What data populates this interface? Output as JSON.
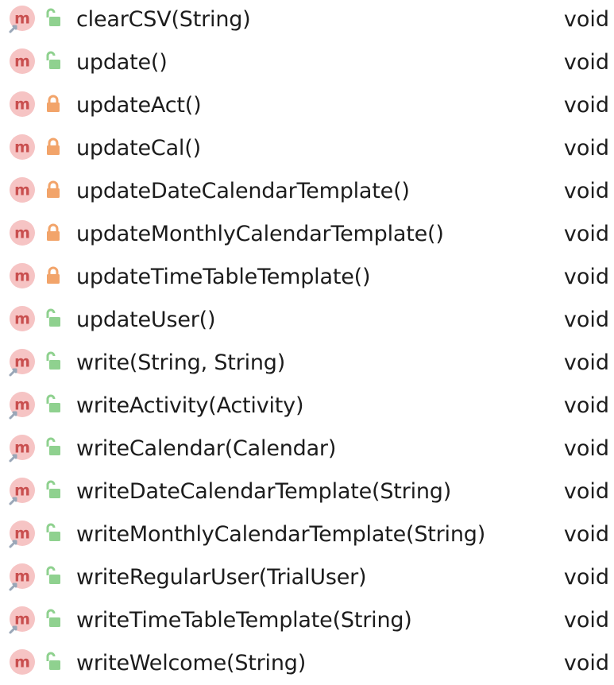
{
  "colors": {
    "method_badge_fill": "#f6c4c4",
    "method_badge_text": "#c94f4f",
    "override_arrow": "#9aa7b8",
    "lock_public": "#8fd18f",
    "lock_private": "#f2a46a",
    "text": "#1c1c1c"
  },
  "methods": [
    {
      "signature": "clearCSV(String)",
      "return_type": "void",
      "visibility": "public",
      "override": true
    },
    {
      "signature": "update()",
      "return_type": "void",
      "visibility": "public",
      "override": false
    },
    {
      "signature": "updateAct()",
      "return_type": "void",
      "visibility": "private",
      "override": false
    },
    {
      "signature": "updateCal()",
      "return_type": "void",
      "visibility": "private",
      "override": false
    },
    {
      "signature": "updateDateCalendarTemplate()",
      "return_type": "void",
      "visibility": "private",
      "override": false
    },
    {
      "signature": "updateMonthlyCalendarTemplate()",
      "return_type": "void",
      "visibility": "private",
      "override": false
    },
    {
      "signature": "updateTimeTableTemplate()",
      "return_type": "void",
      "visibility": "private",
      "override": false
    },
    {
      "signature": "updateUser()",
      "return_type": "void",
      "visibility": "public",
      "override": false
    },
    {
      "signature": "write(String, String)",
      "return_type": "void",
      "visibility": "public",
      "override": true
    },
    {
      "signature": "writeActivity(Activity)",
      "return_type": "void",
      "visibility": "public",
      "override": true
    },
    {
      "signature": "writeCalendar(Calendar)",
      "return_type": "void",
      "visibility": "public",
      "override": true
    },
    {
      "signature": "writeDateCalendarTemplate(String)",
      "return_type": "void",
      "visibility": "public",
      "override": true
    },
    {
      "signature": "writeMonthlyCalendarTemplate(String)",
      "return_type": "void",
      "visibility": "public",
      "override": true
    },
    {
      "signature": "writeRegularUser(TrialUser)",
      "return_type": "void",
      "visibility": "public",
      "override": true
    },
    {
      "signature": "writeTimeTableTemplate(String)",
      "return_type": "void",
      "visibility": "public",
      "override": true
    },
    {
      "signature": "writeWelcome(String)",
      "return_type": "void",
      "visibility": "public",
      "override": false
    }
  ]
}
